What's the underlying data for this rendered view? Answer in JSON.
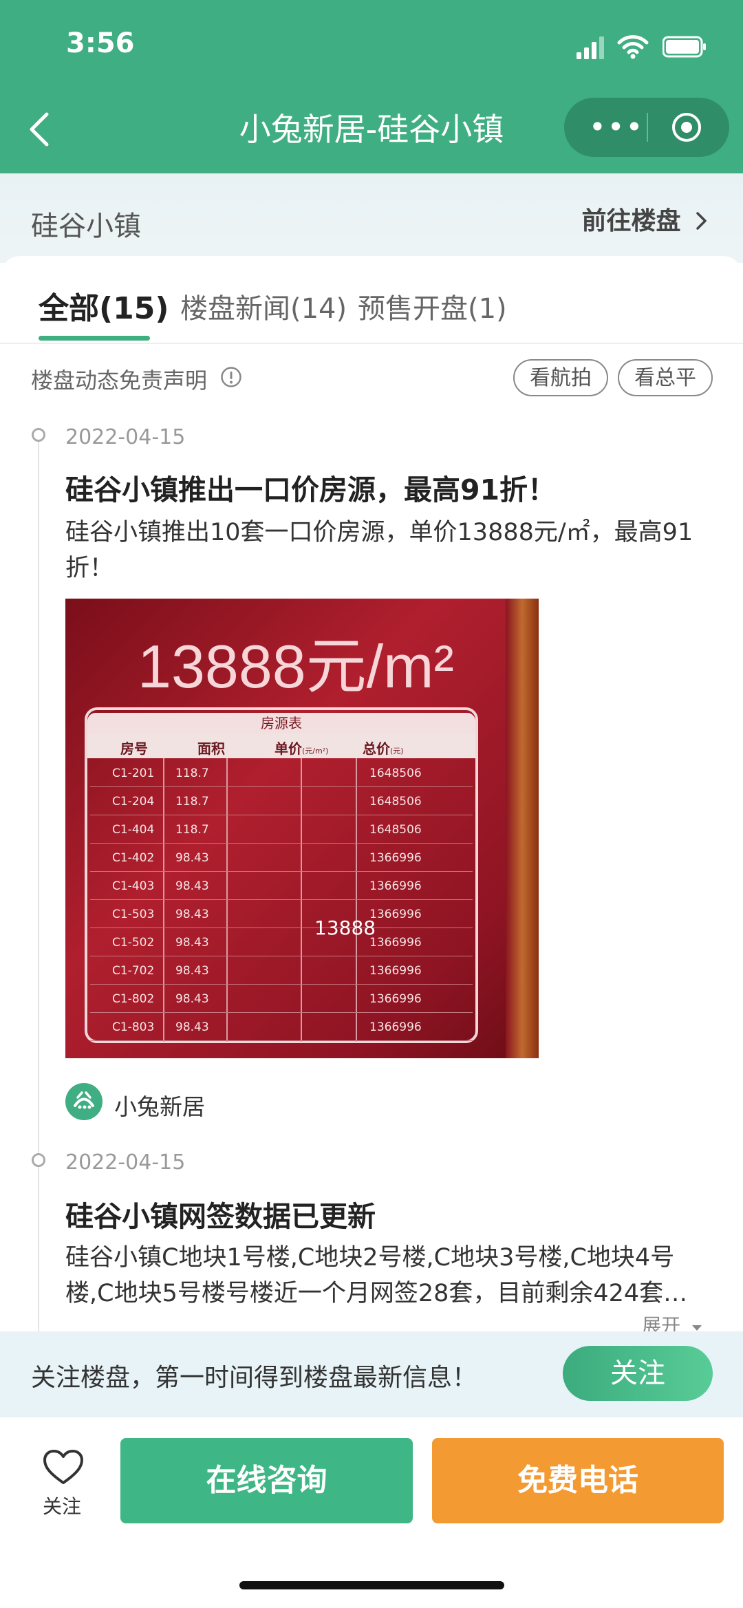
{
  "status_bar": {
    "time": "3:56"
  },
  "nav": {
    "title": "小兔新居-硅谷小镇",
    "more_glyph": "•••"
  },
  "subheader": {
    "project_name": "硅谷小镇",
    "goto_label": "前往楼盘"
  },
  "tabs": [
    {
      "label": "全部(15)",
      "active": true
    },
    {
      "label": "楼盘新闻(14)",
      "active": false
    },
    {
      "label": "预售开盘(1)",
      "active": false
    }
  ],
  "toolbar": {
    "disclaimer": "楼盘动态免责声明",
    "aerial_button": "看航拍",
    "plan_button": "看总平"
  },
  "news": [
    {
      "date": "2022-04-15",
      "title": "硅谷小镇推出一口价房源，最高91折！",
      "body": "硅谷小镇推出10套一口价房源，单价13888元/㎡，最高91折！",
      "author": "小兔新居"
    },
    {
      "date": "2022-04-15",
      "title": "硅谷小镇网签数据已更新",
      "body": "硅谷小镇C地块1号楼,C地块2号楼,C地块3号楼,C地块4号楼,C地块5号楼号楼近一个月网签28套，目前剩余424套…",
      "expand_label": "展开"
    }
  ],
  "photo": {
    "big_price": "13888元/m²",
    "table_caption": "房源表",
    "headers": [
      "房号",
      "面积",
      "单价",
      "总价"
    ],
    "header_units": {
      "price": "(元/m²)",
      "total": "(元)"
    },
    "unit_price": "13888",
    "rows": [
      [
        "C1-201",
        "118.7",
        "1648506"
      ],
      [
        "C1-204",
        "118.7",
        "1648506"
      ],
      [
        "C1-404",
        "118.7",
        "1648506"
      ],
      [
        "C1-402",
        "98.43",
        "1366996"
      ],
      [
        "C1-403",
        "98.43",
        "1366996"
      ],
      [
        "C1-503",
        "98.43",
        "1366996"
      ],
      [
        "C1-502",
        "98.43",
        "1366996"
      ],
      [
        "C1-702",
        "98.43",
        "1366996"
      ],
      [
        "C1-802",
        "98.43",
        "1366996"
      ],
      [
        "C1-803",
        "98.43",
        "1366996"
      ]
    ]
  },
  "banner": {
    "text": "关注楼盘，第一时间得到楼盘最新信息！",
    "button": "关注"
  },
  "bottom": {
    "favorite_label": "关注",
    "consult_button": "在线咨询",
    "call_button": "免费电话"
  },
  "colors": {
    "brand_green": "#3fae82",
    "call_orange": "#f39a33"
  }
}
